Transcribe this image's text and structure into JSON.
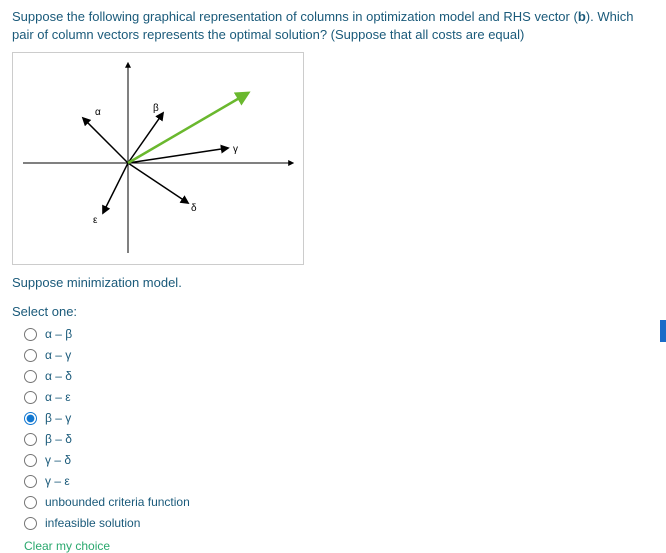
{
  "question": {
    "prefix": "Suppose the following graphical representation of columns in optimization model and RHS vector (",
    "bold": "b",
    "suffix": "). Which pair of column vectors represents the optimal solution? (Suppose that all costs are equal)"
  },
  "graph": {
    "labels": {
      "alpha": "α",
      "beta": "β",
      "gamma": "γ",
      "delta": "δ",
      "epsilon": "ε"
    }
  },
  "subtext": "Suppose minimization model.",
  "select_label": "Select one:",
  "options": [
    {
      "id": "opt1",
      "label": "α – β",
      "selected": false
    },
    {
      "id": "opt2",
      "label": "α – γ",
      "selected": false
    },
    {
      "id": "opt3",
      "label": "α – δ",
      "selected": false
    },
    {
      "id": "opt4",
      "label": "α – ε",
      "selected": false
    },
    {
      "id": "opt5",
      "label": "β – γ",
      "selected": true
    },
    {
      "id": "opt6",
      "label": "β – δ",
      "selected": false
    },
    {
      "id": "opt7",
      "label": "γ – δ",
      "selected": false
    },
    {
      "id": "opt8",
      "label": "γ – ε",
      "selected": false
    },
    {
      "id": "opt9",
      "label": "unbounded criteria function",
      "selected": false
    },
    {
      "id": "opt10",
      "label": "infeasible solution",
      "selected": false
    }
  ],
  "clear_label": "Clear my choice"
}
